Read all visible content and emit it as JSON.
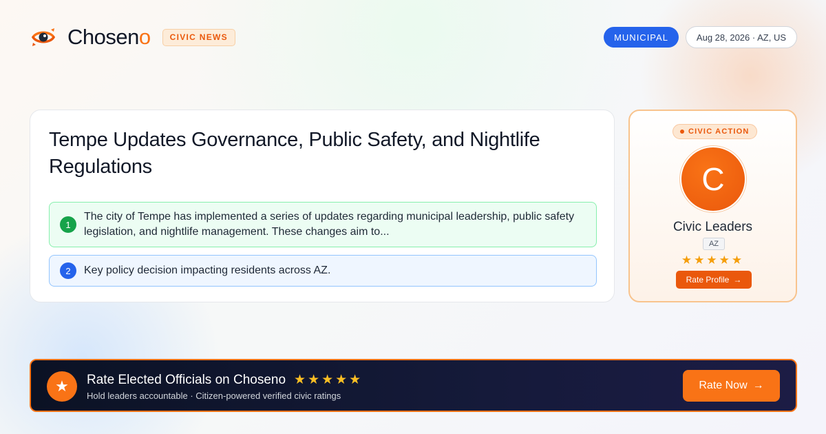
{
  "header": {
    "brand_text": "Chosen",
    "brand_accent": "o",
    "category_badge": "CIVIC NEWS",
    "topic_pill": "MUNICIPAL",
    "date_location": "Aug 28, 2026 · AZ, US"
  },
  "article": {
    "headline": "Tempe Updates Governance, Public Safety, and Nightlife Regulations",
    "points": [
      {
        "number": "1",
        "text": "The city of Tempe has implemented a series of updates regarding municipal leadership, public safety legislation, and nightlife management. These changes aim to..."
      },
      {
        "number": "2",
        "text": "Key policy decision impacting residents across AZ."
      }
    ]
  },
  "side_card": {
    "badge": "CIVIC ACTION",
    "avatar_letter": "C",
    "name": "Civic Leaders",
    "state": "AZ",
    "rating_stars": 5,
    "stars": "★★★★★",
    "button_label": "Rate Profile",
    "button_icon": "→"
  },
  "banner": {
    "icon": "★",
    "title": "Rate Elected Officials on Choseno",
    "stars": "★★★★★",
    "subtitle": "Hold leaders accountable · Citizen-powered verified civic ratings",
    "button_label": "Rate Now",
    "button_icon": "→"
  },
  "colors": {
    "accent_orange": "#f97316",
    "municipal_blue": "#2563eb",
    "point_green": "#16a34a",
    "banner_dark": "#0b1224"
  },
  "icons": {
    "logo": "eye-logo-icon",
    "arrow": "arrow-right-icon",
    "star": "star-icon"
  }
}
